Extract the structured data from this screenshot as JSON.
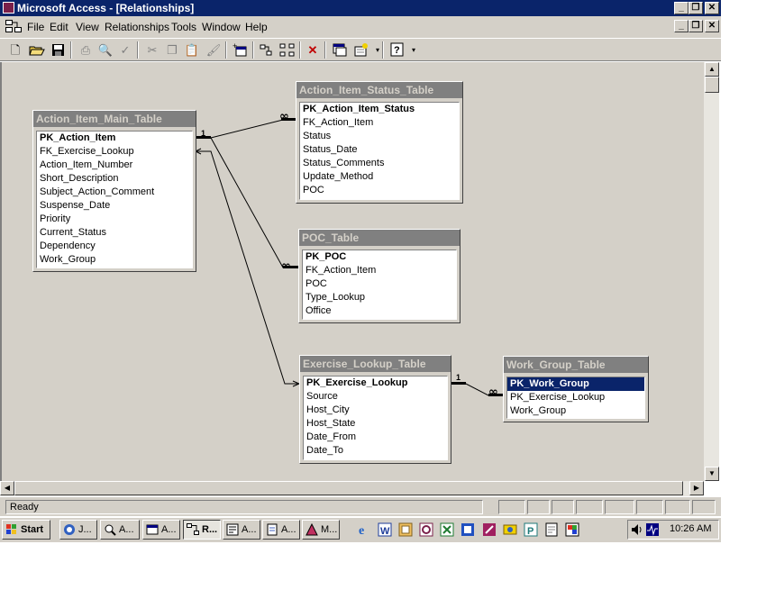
{
  "window": {
    "title": "Microsoft Access - [Relationships]"
  },
  "menu": [
    "File",
    "Edit",
    "View",
    "Relationships",
    "Tools",
    "Window",
    "Help"
  ],
  "toolbar": {
    "buttons": [
      "new-icon",
      "open-icon",
      "save-icon",
      "print-icon",
      "print-preview-icon",
      "spelling-icon",
      "cut-icon",
      "copy-icon",
      "paste-icon",
      "format-painter-icon",
      "show-table-icon",
      "show-direct-icon",
      "show-all-icon",
      "delete-icon",
      "database-window-icon",
      "new-object-icon",
      "help-icon"
    ]
  },
  "tables": {
    "main": {
      "caption": "Action_Item_Main_Table",
      "fields": [
        "PK_Action_Item",
        "FK_Exercise_Lookup",
        "Action_Item_Number",
        "Short_Description",
        "Subject_Action_Comment",
        "Suspense_Date",
        "Priority",
        "Current_Status",
        "Dependency",
        "Work_Group"
      ]
    },
    "status": {
      "caption": "Action_Item_Status_Table",
      "fields": [
        "PK_Action_Item_Status",
        "FK_Action_Item",
        "Status",
        "Status_Date",
        "Status_Comments",
        "Update_Method",
        "POC"
      ]
    },
    "poc": {
      "caption": "POC_Table",
      "fields": [
        "PK_POC",
        "FK_Action_Item",
        "POC",
        "Type_Lookup",
        "Office"
      ]
    },
    "exercise": {
      "caption": "Exercise_Lookup_Table",
      "fields": [
        "PK_Exercise_Lookup",
        "Source",
        "Host_City",
        "Host_State",
        "Date_From",
        "Date_To"
      ]
    },
    "workgroup": {
      "caption": "Work_Group_Table",
      "fields": [
        "PK_Work_Group",
        "PK_Exercise_Lookup",
        "Work_Group"
      ]
    }
  },
  "relationships": {
    "one_label": "1",
    "many_label": "∞"
  },
  "statusbar": {
    "text": "Ready"
  },
  "taskbar": {
    "start_label": "Start",
    "tasks": [
      "J...",
      "A...",
      "A...",
      "R...",
      "A...",
      "A...",
      "M..."
    ],
    "clock": "10:26 AM"
  },
  "colors": {
    "title_bar": "#0a246a",
    "face": "#d4d0c8",
    "inactive_caption": "#808080",
    "selection": "#0a246a"
  }
}
